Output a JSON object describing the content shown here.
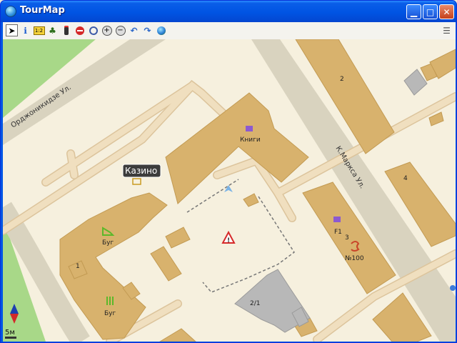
{
  "window": {
    "title": "TourMap"
  },
  "toolbar": {
    "tools": [
      {
        "name": "pointer-tool",
        "glyph": "➤"
      },
      {
        "name": "info-tool",
        "glyph": "ℹ"
      },
      {
        "name": "scale-tool",
        "glyph": "1:2"
      },
      {
        "name": "tree-tool",
        "glyph": "♣"
      },
      {
        "name": "traffic-light-tool",
        "glyph": "🚦"
      },
      {
        "name": "stop-tool",
        "glyph": "⊖"
      },
      {
        "name": "search-tool",
        "glyph": "🔍"
      },
      {
        "name": "zoom-in-tool",
        "glyph": "⊕"
      },
      {
        "name": "zoom-out-tool",
        "glyph": "⊖"
      },
      {
        "name": "undo-tool",
        "glyph": "↶"
      },
      {
        "name": "redo-tool",
        "glyph": "↷"
      },
      {
        "name": "globe-tool",
        "glyph": "🌐"
      }
    ]
  },
  "map": {
    "streets": {
      "ordzhonikidze": "Орджоникидзе Ул.",
      "marksa": "К.Маркса Ул."
    },
    "poi": {
      "casino": "Казино",
      "books": "Книги",
      "bug_top": "Буг",
      "bug_bottom": "Буг",
      "f1": "F1",
      "no100": "№100"
    },
    "house_numbers": {
      "n2": "2",
      "n4": "4",
      "n3": "3",
      "n1": "1",
      "n21": "2/1"
    },
    "scale": "5м",
    "colors": {
      "building": "#d8b26d",
      "road": "#f0dfbf",
      "road_edge": "#dcc49c",
      "background": "#f6f0de",
      "grass": "#a8d888",
      "wide_road": "#d9d3bf"
    }
  }
}
